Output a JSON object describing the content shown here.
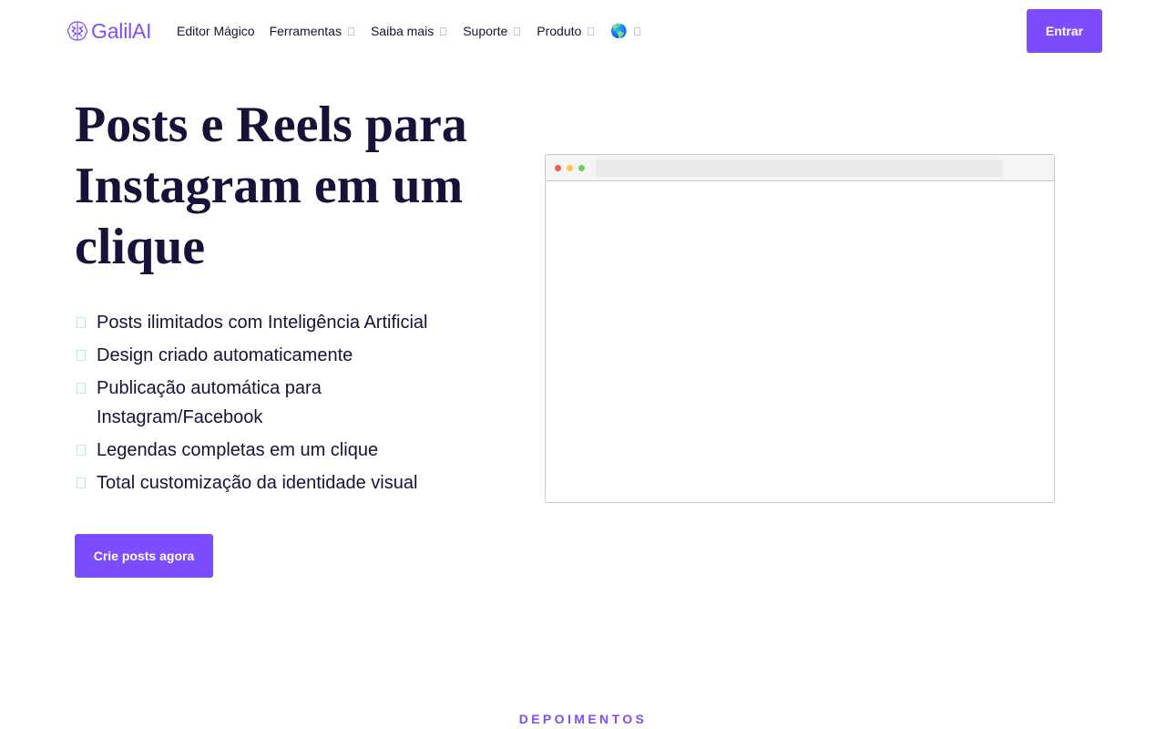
{
  "brand": {
    "name": "GalilAI",
    "color": "#7c4dff"
  },
  "nav": {
    "items": [
      {
        "label": "Editor Mágico",
        "dropdown": false
      },
      {
        "label": "Ferramentas",
        "dropdown": true
      },
      {
        "label": "Saiba mais",
        "dropdown": true
      },
      {
        "label": "Suporte",
        "dropdown": true
      },
      {
        "label": "Produto",
        "dropdown": true
      }
    ],
    "language_icon": "🌎",
    "login_label": "Entrar"
  },
  "hero": {
    "title": "Posts e Reels para Instagram em um clique",
    "features": [
      "Posts ilimitados com Inteligência Artificial",
      "Design criado automaticamente",
      "Publicação automática para Instagram/Facebook",
      "Legendas completas em um clique",
      "Total customização da identidade visual"
    ],
    "cta_label": "Crie posts agora"
  },
  "testimonials": {
    "label": "DEPOIMENTOS"
  },
  "icons": {
    "logo": "brain-logo-icon",
    "chevron": "chevron-down-icon",
    "check": "check-icon",
    "globe": "globe-icon"
  }
}
